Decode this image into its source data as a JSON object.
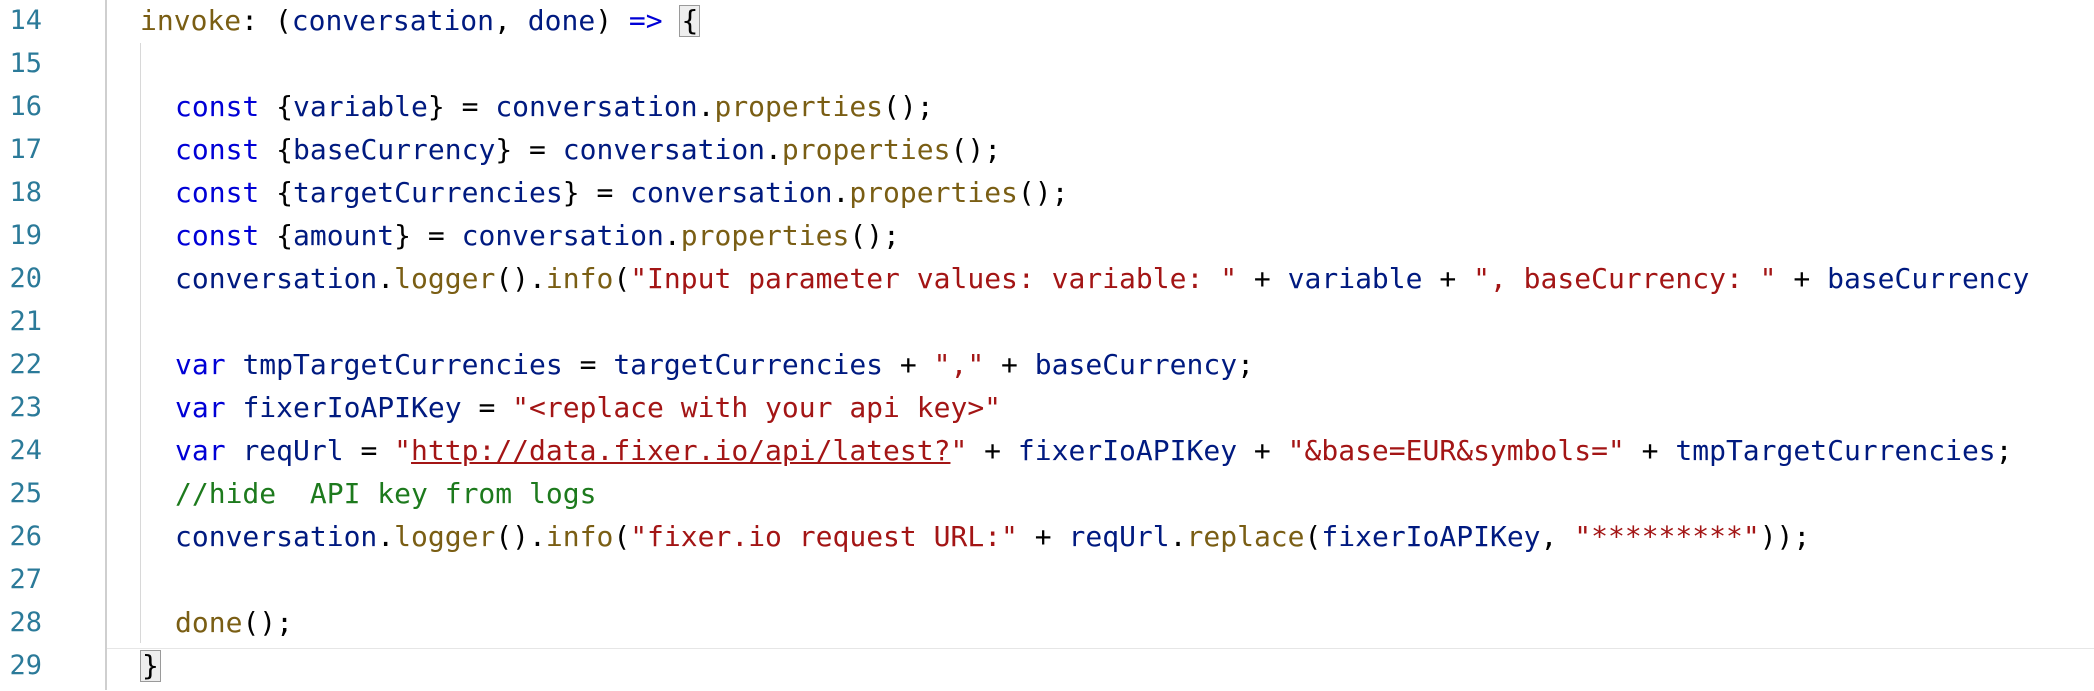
{
  "editor": {
    "lines": [
      {
        "number": "14",
        "tokens": [
          {
            "t": "invoke",
            "c": "fn"
          },
          {
            "t": ": (",
            "c": "pr"
          },
          {
            "t": "conversation",
            "c": "id"
          },
          {
            "t": ", ",
            "c": "pr"
          },
          {
            "t": "done",
            "c": "id"
          },
          {
            "t": ") ",
            "c": "pr"
          },
          {
            "t": "=>",
            "c": "kw"
          },
          {
            "t": " ",
            "c": "pr"
          },
          {
            "t": "{",
            "c": "brace"
          }
        ]
      },
      {
        "number": "15",
        "tokens": []
      },
      {
        "number": "16",
        "tokens": [
          {
            "t": "const ",
            "c": "kw"
          },
          {
            "t": "{",
            "c": "pr"
          },
          {
            "t": "variable",
            "c": "id"
          },
          {
            "t": "} = ",
            "c": "pr"
          },
          {
            "t": "conversation",
            "c": "id"
          },
          {
            "t": ".",
            "c": "pr"
          },
          {
            "t": "properties",
            "c": "fn"
          },
          {
            "t": "();",
            "c": "pr"
          }
        ]
      },
      {
        "number": "17",
        "tokens": [
          {
            "t": "const ",
            "c": "kw"
          },
          {
            "t": "{",
            "c": "pr"
          },
          {
            "t": "baseCurrency",
            "c": "id"
          },
          {
            "t": "} = ",
            "c": "pr"
          },
          {
            "t": "conversation",
            "c": "id"
          },
          {
            "t": ".",
            "c": "pr"
          },
          {
            "t": "properties",
            "c": "fn"
          },
          {
            "t": "();",
            "c": "pr"
          }
        ]
      },
      {
        "number": "18",
        "tokens": [
          {
            "t": "const ",
            "c": "kw"
          },
          {
            "t": "{",
            "c": "pr"
          },
          {
            "t": "targetCurrencies",
            "c": "id"
          },
          {
            "t": "} = ",
            "c": "pr"
          },
          {
            "t": "conversation",
            "c": "id"
          },
          {
            "t": ".",
            "c": "pr"
          },
          {
            "t": "properties",
            "c": "fn"
          },
          {
            "t": "();",
            "c": "pr"
          }
        ]
      },
      {
        "number": "19",
        "tokens": [
          {
            "t": "const ",
            "c": "kw"
          },
          {
            "t": "{",
            "c": "pr"
          },
          {
            "t": "amount",
            "c": "id"
          },
          {
            "t": "} = ",
            "c": "pr"
          },
          {
            "t": "conversation",
            "c": "id"
          },
          {
            "t": ".",
            "c": "pr"
          },
          {
            "t": "properties",
            "c": "fn"
          },
          {
            "t": "();",
            "c": "pr"
          }
        ]
      },
      {
        "number": "20",
        "tokens": [
          {
            "t": "conversation",
            "c": "id"
          },
          {
            "t": ".",
            "c": "pr"
          },
          {
            "t": "logger",
            "c": "fn"
          },
          {
            "t": "().",
            "c": "pr"
          },
          {
            "t": "info",
            "c": "fn"
          },
          {
            "t": "(",
            "c": "pr"
          },
          {
            "t": "\"Input parameter values: variable: \"",
            "c": "st"
          },
          {
            "t": " + ",
            "c": "pr"
          },
          {
            "t": "variable",
            "c": "id"
          },
          {
            "t": " + ",
            "c": "pr"
          },
          {
            "t": "\", baseCurrency: \"",
            "c": "st"
          },
          {
            "t": " + ",
            "c": "pr"
          },
          {
            "t": "baseCurrency",
            "c": "id"
          }
        ]
      },
      {
        "number": "21",
        "tokens": []
      },
      {
        "number": "22",
        "tokens": [
          {
            "t": "var ",
            "c": "kw"
          },
          {
            "t": "tmpTargetCurrencies",
            "c": "id"
          },
          {
            "t": " = ",
            "c": "pr"
          },
          {
            "t": "targetCurrencies",
            "c": "id"
          },
          {
            "t": " + ",
            "c": "pr"
          },
          {
            "t": "\",\"",
            "c": "st"
          },
          {
            "t": " + ",
            "c": "pr"
          },
          {
            "t": "baseCurrency",
            "c": "id"
          },
          {
            "t": ";",
            "c": "pr"
          }
        ]
      },
      {
        "number": "23",
        "tokens": [
          {
            "t": "var ",
            "c": "kw"
          },
          {
            "t": "fixerIoAPIKey",
            "c": "id"
          },
          {
            "t": " = ",
            "c": "pr"
          },
          {
            "t": "\"<replace with your api key>\"",
            "c": "st"
          }
        ]
      },
      {
        "number": "24",
        "tokens": [
          {
            "t": "var ",
            "c": "kw"
          },
          {
            "t": "reqUrl",
            "c": "id"
          },
          {
            "t": " = ",
            "c": "pr"
          },
          {
            "t": "\"",
            "c": "st"
          },
          {
            "t": "http://data.fixer.io/api/latest?",
            "c": "url"
          },
          {
            "t": "\"",
            "c": "st"
          },
          {
            "t": " + ",
            "c": "pr"
          },
          {
            "t": "fixerIoAPIKey",
            "c": "id"
          },
          {
            "t": " + ",
            "c": "pr"
          },
          {
            "t": "\"&base=EUR&symbols=\"",
            "c": "st"
          },
          {
            "t": " + ",
            "c": "pr"
          },
          {
            "t": "tmpTargetCurrencies",
            "c": "id"
          },
          {
            "t": ";",
            "c": "pr"
          }
        ]
      },
      {
        "number": "25",
        "tokens": [
          {
            "t": "//hide  API key from logs",
            "c": "cm"
          }
        ]
      },
      {
        "number": "26",
        "tokens": [
          {
            "t": "conversation",
            "c": "id"
          },
          {
            "t": ".",
            "c": "pr"
          },
          {
            "t": "logger",
            "c": "fn"
          },
          {
            "t": "().",
            "c": "pr"
          },
          {
            "t": "info",
            "c": "fn"
          },
          {
            "t": "(",
            "c": "pr"
          },
          {
            "t": "\"fixer.io request URL:\"",
            "c": "st"
          },
          {
            "t": " + ",
            "c": "pr"
          },
          {
            "t": "reqUrl",
            "c": "id"
          },
          {
            "t": ".",
            "c": "pr"
          },
          {
            "t": "replace",
            "c": "fn"
          },
          {
            "t": "(",
            "c": "pr"
          },
          {
            "t": "fixerIoAPIKey",
            "c": "id"
          },
          {
            "t": ", ",
            "c": "pr"
          },
          {
            "t": "\"*********\"",
            "c": "st"
          },
          {
            "t": "));",
            "c": "pr"
          }
        ]
      },
      {
        "number": "27",
        "tokens": []
      },
      {
        "number": "28",
        "tokens": [
          {
            "t": "done",
            "c": "fn"
          },
          {
            "t": "();",
            "c": "pr"
          }
        ]
      },
      {
        "number": "29",
        "tokens": [
          {
            "t": "}",
            "c": "brace"
          }
        ]
      }
    ]
  },
  "colors": {
    "line_number": "#2b7a99",
    "keyword": "#0000d6",
    "identifier": "#001a80",
    "function": "#7a5e14",
    "string": "#a31515",
    "comment": "#1d7a1d",
    "gutter_border": "#cfcfcf"
  }
}
